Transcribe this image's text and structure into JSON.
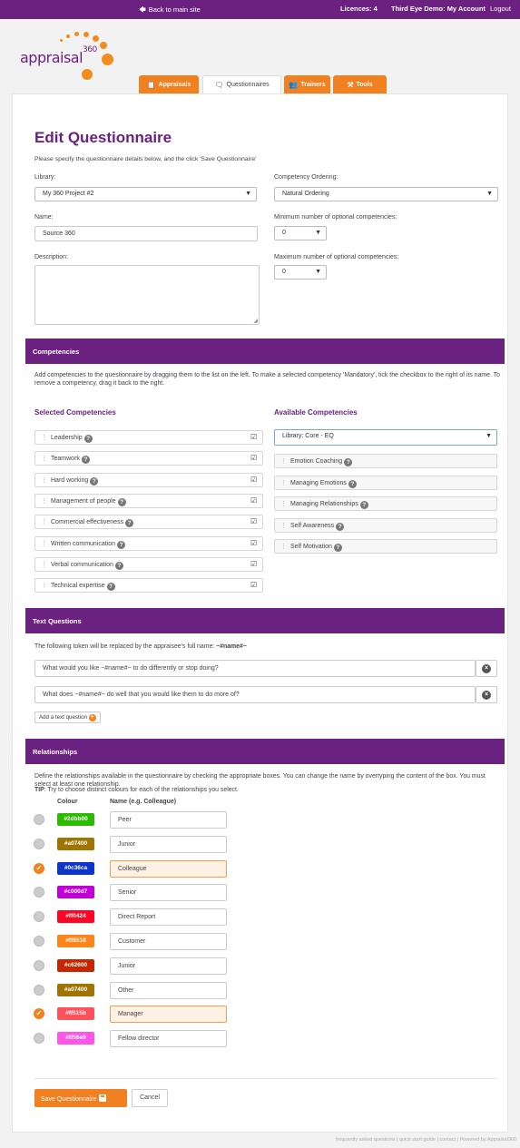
{
  "topbar": {
    "back": "Back to main site",
    "licences": "Licences: 4",
    "account_name": "Third Eye Demo:",
    "account_link": "My Account",
    "logout": "Logout"
  },
  "logo": {
    "text": "appraisal",
    "sup": "360"
  },
  "tabs": [
    {
      "label": "Appraisals",
      "icon": "clipboard-icon"
    },
    {
      "label": "Questionnaires",
      "icon": "chat-icon"
    },
    {
      "label": "Trainers",
      "icon": "users-icon"
    },
    {
      "label": "Tools",
      "icon": "tools-icon"
    }
  ],
  "page": {
    "title": "Edit Questionnaire",
    "intro": "Please specify the questionnaire details below, and the click 'Save Questionnaire'"
  },
  "form": {
    "library_label": "Library:",
    "library_value": "My 360 Project #2",
    "ordering_label": "Competency Ordering:",
    "ordering_value": "Natural Ordering",
    "name_label": "Name:",
    "name_value": "Source 360",
    "min_label": "Minimum number of optional competencies:",
    "min_value": "0",
    "description_label": "Description:",
    "max_label": "Maximum number of optional competencies:",
    "max_value": "0"
  },
  "competencies": {
    "heading": "Competencies",
    "help": "Add competencies to the questionnaire by dragging them to the list on the left. To make a selected competency 'Mandatory', tick the checkbox to the right of its name. To remove a competency, drag it back to the right.",
    "selected_title": "Selected Competencies",
    "available_title": "Available Competencies",
    "selected": [
      "Leadership",
      "Teamwork",
      "Hard working",
      "Management of people",
      "Commercial effectiveness",
      "Written communication",
      "Verbal communication",
      "Technical expertise"
    ],
    "available_library": "Library: Core - EQ",
    "available": [
      "Emotion Coaching",
      "Managing Emotions",
      "Managing Relationships",
      "Self Awareness",
      "Self Motivation"
    ]
  },
  "text_questions": {
    "heading": "Text Questions",
    "token_note": "The following token will be replaced by the appraisee's full name:",
    "token": "~#name#~",
    "questions": [
      "What would you like ~#name#~ to do differently or stop doing?",
      "What does ~#name#~ do well that you would like them to do more of?"
    ],
    "add_label": "Add a text question"
  },
  "relationships": {
    "heading": "Relationships",
    "help": "Define the relationships available in the questionnaire by checking the appropriate boxes. You can change the name by overtyping the content of the box. You must select at least one relationship.",
    "tip_label": "TIP",
    "tip_text": ": Try to choose distinct colours for each of the relationships you select.",
    "colour_header": "Colour",
    "name_header": "Name (e.g. Colleague)",
    "rows": [
      {
        "colour": "#2dbb00",
        "name": "Peer",
        "checked": false
      },
      {
        "colour": "#a07400",
        "name": "Junior",
        "checked": false
      },
      {
        "colour": "#0c36ca",
        "name": "Colleague",
        "checked": true
      },
      {
        "colour": "#c000d7",
        "name": "Senior",
        "checked": false
      },
      {
        "colour": "#ff0424",
        "name": "Direct Report",
        "checked": false
      },
      {
        "colour": "#ff8518",
        "name": "Customer",
        "checked": false
      },
      {
        "colour": "#c62600",
        "name": "Junior",
        "checked": false
      },
      {
        "colour": "#a07400",
        "name": "Other",
        "checked": false
      },
      {
        "colour": "#ff515b",
        "name": "Manager",
        "checked": true
      },
      {
        "colour": "#ff56e9",
        "name": "Fellow director",
        "checked": false
      }
    ]
  },
  "actions": {
    "save": "Save Questionnaire",
    "cancel": "Cancel"
  },
  "footer": "frequently asked questions | quick start guide | contact | Powered by Appraisal360"
}
